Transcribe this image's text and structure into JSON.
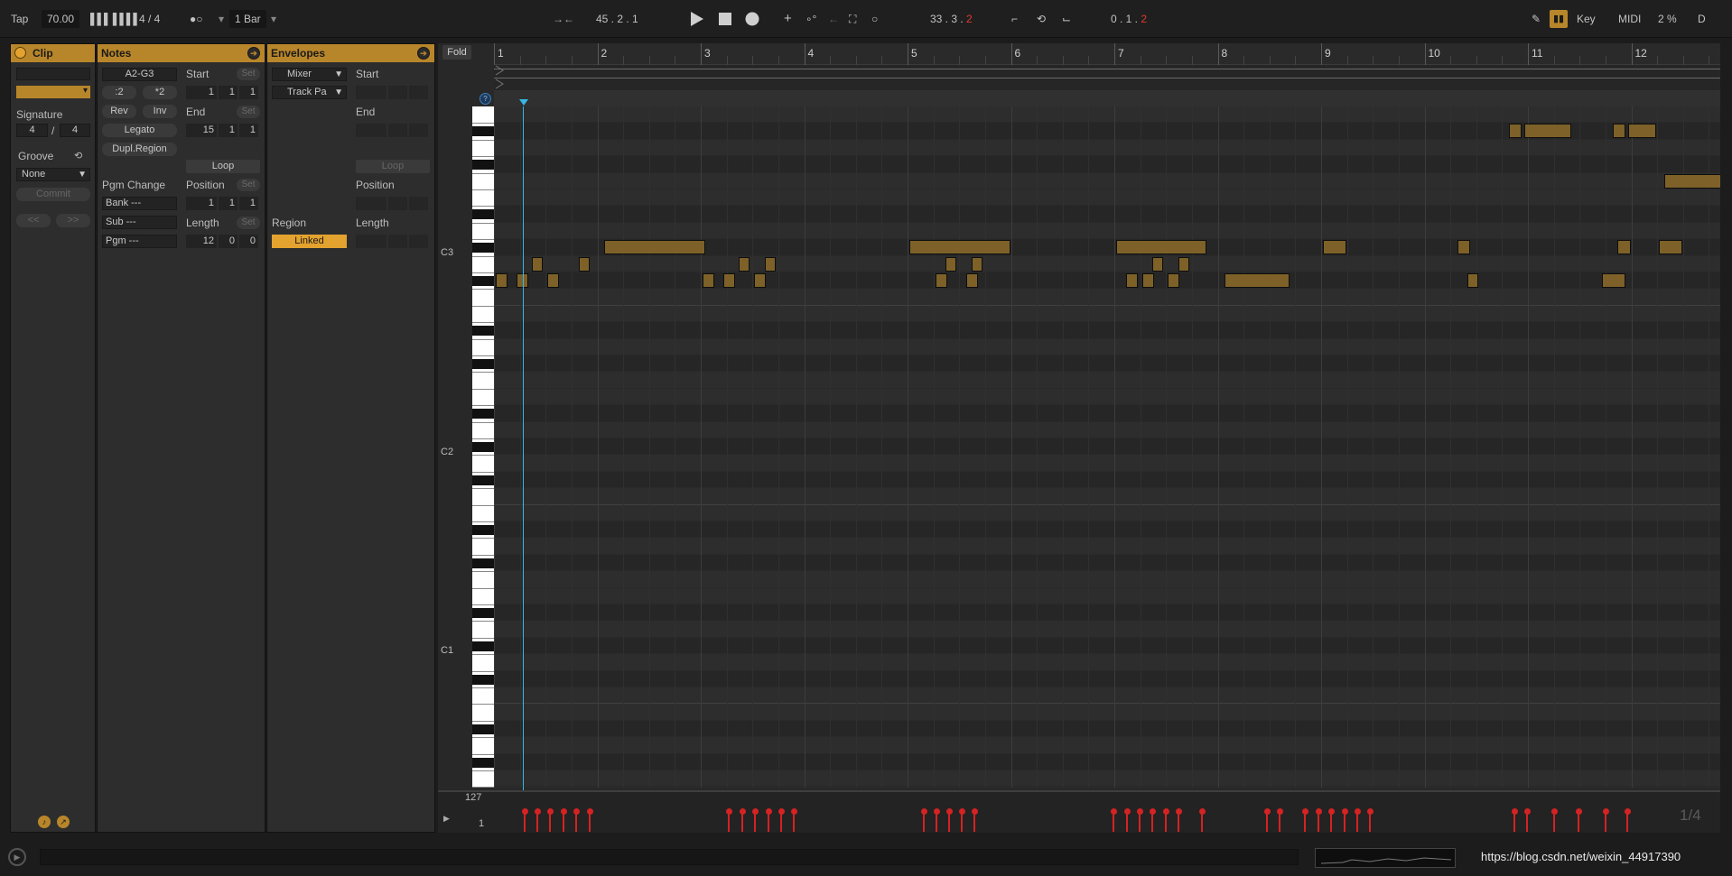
{
  "transport": {
    "tap": "Tap",
    "tempo": "70.00",
    "metro_bars": "▌▌▌ ▌▌▌▌",
    "signature": "4 / 4",
    "follow": "●○",
    "quantize": "1 Bar",
    "position": "45 .  2 .  1",
    "loop_start": "33 .  3 .",
    "loop_start_red": "2",
    "loop_len": "0 .  1 .",
    "loop_len_red": "2",
    "key": "Key",
    "midi": "MIDI",
    "cpu": "2 %",
    "d": "D"
  },
  "clip_panel": {
    "title": "Clip",
    "signature_label": "Signature",
    "sig_num": "4",
    "sig_slash": "/",
    "sig_den": "4",
    "groove_label": "Groove",
    "groove_value": "None",
    "commit": "Commit",
    "prev": "<<",
    "next": ">>"
  },
  "notes_panel": {
    "title": "Notes",
    "range": "A2-G3",
    "half": ":2",
    "double": "*2",
    "rev": "Rev",
    "inv": "Inv",
    "legato": "Legato",
    "dupl": "Dupl.Region",
    "start_label": "Start",
    "end_label": "End",
    "loop": "Loop",
    "position_label": "Position",
    "length_label": "Length",
    "set": "Set",
    "start": [
      "1",
      "1",
      "1"
    ],
    "end": [
      "15",
      "1",
      "1"
    ],
    "position": [
      "1",
      "1",
      "1"
    ],
    "length": [
      "12",
      "0",
      "0"
    ],
    "pgm_change": "Pgm Change",
    "bank": "Bank ---",
    "sub": "Sub ---",
    "pgm": "Pgm ---"
  },
  "env_panel": {
    "title": "Envelopes",
    "device": "Mixer",
    "control": "Track Pa",
    "start_label": "Start",
    "end_label": "End",
    "loop": "Loop",
    "position_label": "Position",
    "region_label": "Region",
    "length_label": "Length",
    "linked": "Linked"
  },
  "editor": {
    "fold": "Fold",
    "ruler": [
      "1",
      "2",
      "3",
      "4",
      "5",
      "6",
      "7",
      "8",
      "9",
      "10",
      "11",
      "12"
    ],
    "c3": "C3",
    "c2": "C2",
    "c1": "C1",
    "vel_max": "127",
    "vel_min": "1",
    "grid_info": "1/4"
  },
  "chart_data": {
    "type": "piano-roll",
    "note_color": "#7d6128",
    "accent": "#b8862a",
    "velocity_color": "#d52222"
  },
  "footer": {
    "url": "https://blog.csdn.net/weixin_44917390"
  }
}
